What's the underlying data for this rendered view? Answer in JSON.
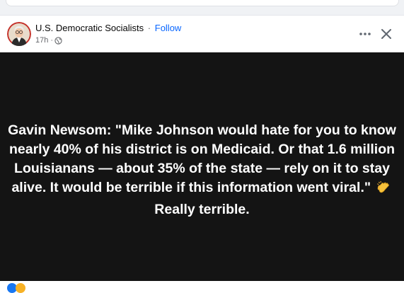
{
  "post": {
    "page_name": "U.S. Democratic Socialists",
    "separator": "·",
    "follow_label": "Follow",
    "time": "17h ·",
    "privacy_icon": "globe-icon",
    "more_icon": "more-icon",
    "close_icon": "close-icon"
  },
  "media": {
    "quote_before_emoji": "Gavin Newsom: \"Mike Johnson would hate for you to know nearly 40% of his district is on Medicaid. Or that 1.6 million Louisianans — about 35% of the state — rely on it to stay alive. It would be terrible if this information went viral.\"",
    "emoji_icon": "clapping-hands-icon",
    "quote_after_emoji": "Really terrible."
  },
  "colors": {
    "accent": "#0866ff",
    "media_background": "#141414",
    "text_secondary": "#65676b"
  }
}
